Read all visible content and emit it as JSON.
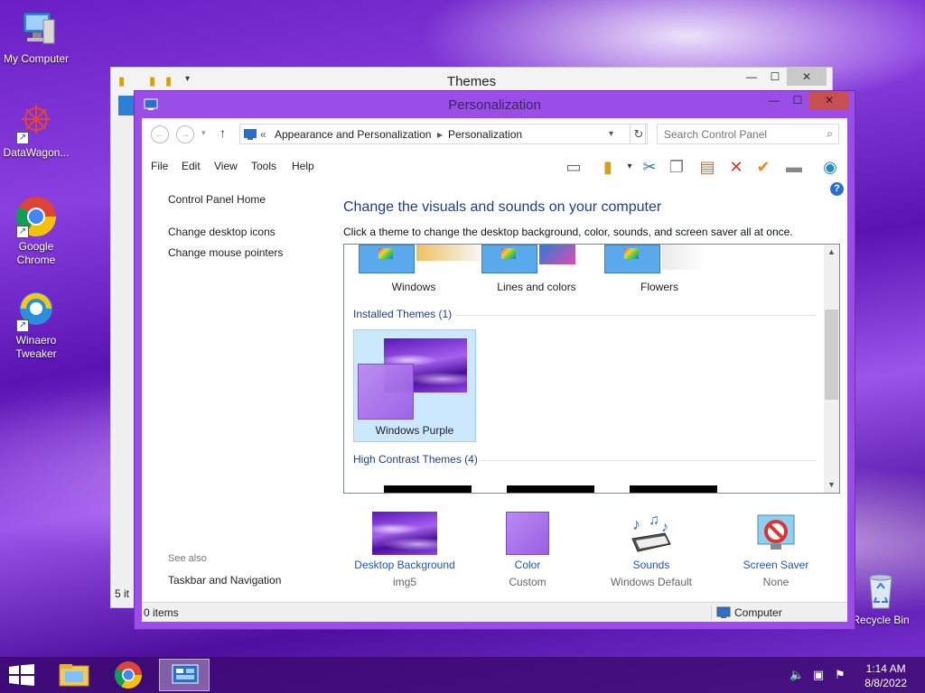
{
  "desktop": {
    "icons": [
      {
        "label": "My Computer"
      },
      {
        "label": "DataWagon..."
      },
      {
        "label": "Google Chrome"
      },
      {
        "label": "Winaero Tweaker"
      },
      {
        "label": "Recycle Bin"
      }
    ]
  },
  "themes_window": {
    "title": "Themes",
    "status_count": "5 it"
  },
  "personalization": {
    "title": "Personalization",
    "breadcrumb": {
      "sep": "«",
      "part1": "Appearance and Personalization",
      "part2": "Personalization"
    },
    "search_placeholder": "Search Control Panel",
    "menu": [
      "File",
      "Edit",
      "View",
      "Tools",
      "Help"
    ],
    "left_pane": {
      "home": "Control Panel Home",
      "links": [
        "Change desktop icons",
        "Change mouse pointers"
      ],
      "see_also": "See also",
      "see_also_link": "Taskbar and Navigation"
    },
    "heading": "Change the visuals and sounds on your computer",
    "subheading": "Click a theme to change the desktop background, color, sounds, and screen saver all at once.",
    "top_themes": [
      "Windows",
      "Lines and colors",
      "Flowers"
    ],
    "installed_group": "Installed Themes (1)",
    "installed_theme": "Windows Purple",
    "high_contrast_group": "High Contrast Themes (4)",
    "bottom": [
      {
        "label": "Desktop Background",
        "sub": "img5"
      },
      {
        "label": "Color",
        "sub": "Custom"
      },
      {
        "label": "Sounds",
        "sub": "Windows Default"
      },
      {
        "label": "Screen Saver",
        "sub": "None"
      }
    ],
    "status_left": "0 items",
    "status_right": "Computer"
  },
  "taskbar": {
    "time": "1:14 AM",
    "date": "8/8/2022"
  },
  "colors": {
    "accent": "#9b4de8",
    "link_blue": "#1e56b0",
    "heading_blue": "#1e3d8f",
    "close_red": "#c7504f"
  }
}
